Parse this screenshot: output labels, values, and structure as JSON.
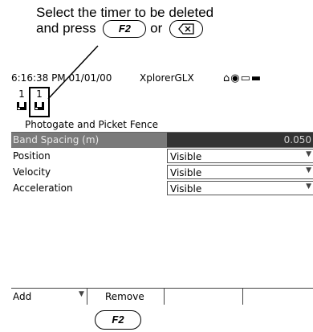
{
  "instruction": {
    "line1": "Select the timer to be deleted",
    "line2_prefix": "and press",
    "key_f2": "F2",
    "or_text": "or"
  },
  "statusbar": {
    "time": "6:16:38 PM",
    "date": "01/01/00",
    "app_name": "XplorerGLX",
    "icons": [
      "home-icon",
      "play-icon",
      "folder-icon",
      "battery-icon"
    ]
  },
  "sensors": [
    {
      "port": "1",
      "icon": "photogate-icon",
      "selected": false
    },
    {
      "port": "1",
      "icon": "photogate-icon",
      "selected": true
    }
  ],
  "sensor_title": "Photogate and Picket Fence",
  "properties": [
    {
      "label": "Band Spacing (m)",
      "value": "0.050"
    },
    {
      "label": "Position",
      "value": "Visible"
    },
    {
      "label": "Velocity",
      "value": "Visible"
    },
    {
      "label": "Acceleration",
      "value": "Visible"
    }
  ],
  "softkeys": {
    "f1": "Add",
    "f2": "Remove",
    "f3": "",
    "f4": ""
  },
  "below_key": "F2",
  "colors": {
    "highlight_row": "#7a7a7a",
    "highlight_value": "#333333"
  }
}
